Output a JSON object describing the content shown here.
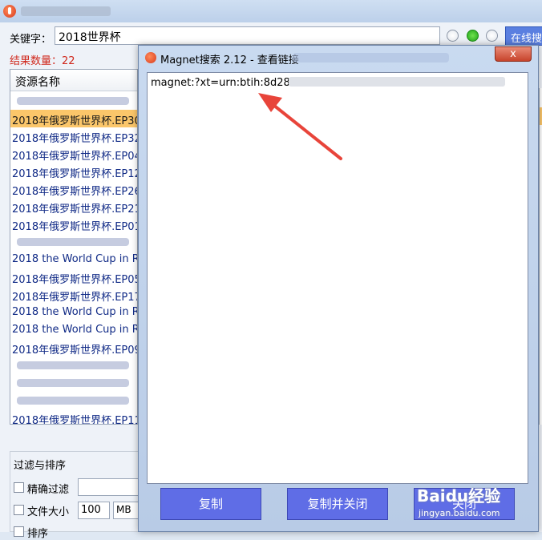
{
  "main": {
    "keyword_label": "关键字：",
    "keyword_value": "2018世界杯",
    "online_button": "在线搜",
    "result_count": "结果数量：22",
    "list_header": "资源名称",
    "rows": [
      {
        "text": "",
        "blur": true
      },
      {
        "text": "2018年俄罗斯世界杯.EP30.",
        "selected": true
      },
      {
        "text": "2018年俄罗斯世界杯.EP32."
      },
      {
        "text": "2018年俄罗斯世界杯.EP04."
      },
      {
        "text": "2018年俄罗斯世界杯.EP12."
      },
      {
        "text": "2018年俄罗斯世界杯.EP26."
      },
      {
        "text": "2018年俄罗斯世界杯.EP21."
      },
      {
        "text": "2018年俄罗斯世界杯.EP01."
      },
      {
        "text": "",
        "blur": true
      },
      {
        "text": "2018 the World Cup in Ru"
      },
      {
        "text": "2018年俄罗斯世界杯.EP05."
      },
      {
        "text": "2018年俄罗斯世界杯.EP17."
      },
      {
        "text": "2018 the World Cup in Ru"
      },
      {
        "text": "2018 the World Cup in Ru"
      },
      {
        "text": "2018年俄罗斯世界杯.EP09."
      },
      {
        "text": "",
        "blur": true
      },
      {
        "text": "",
        "blur": true
      },
      {
        "text": "",
        "blur": true
      },
      {
        "text": "2018年俄罗斯世界杯.EP11."
      }
    ],
    "filter_title": "过滤与排序",
    "exact_filter": "精确过滤",
    "file_size": "文件大小",
    "file_size_value": "100",
    "file_size_unit": "MB",
    "sort_label": "排序"
  },
  "dialog": {
    "title": "Magnet搜索 2.12 - 查看链接",
    "close": "x",
    "magnet_text": "magnet:?xt=urn:btih:8d28",
    "copy_button": "复制",
    "copy_close_button": "复制并关闭",
    "third_button": "关闭"
  },
  "watermark": {
    "brand": "Baidu经验",
    "url": "jingyan.baidu.com"
  },
  "colors": {
    "selected_row": "#fbc66a",
    "button": "#5f6de6",
    "result_count": "#d0281c",
    "arrow": "#e8443a"
  }
}
